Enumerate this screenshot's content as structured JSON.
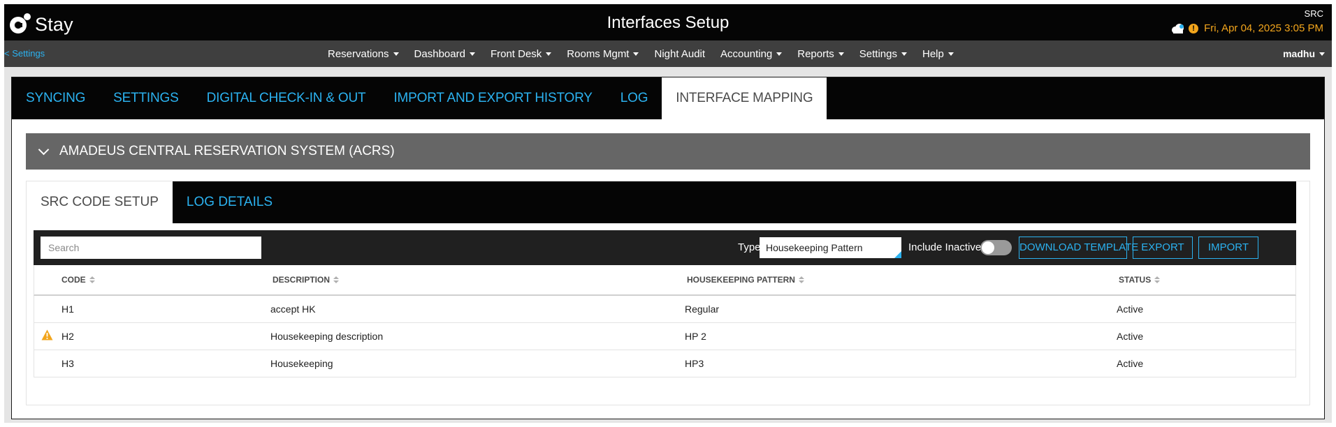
{
  "header": {
    "logo_text": "Stay",
    "title": "Interfaces Setup",
    "property_code": "SRC",
    "datetime": "Fri, Apr 04, 2025 3:05 PM",
    "warning_glyph": "!"
  },
  "nav": {
    "back_label": "<  Settings",
    "items": [
      {
        "label": "Reservations",
        "dropdown": true
      },
      {
        "label": "Dashboard",
        "dropdown": true
      },
      {
        "label": "Front Desk",
        "dropdown": true
      },
      {
        "label": "Rooms Mgmt",
        "dropdown": true
      },
      {
        "label": "Night Audit",
        "dropdown": false
      },
      {
        "label": "Accounting",
        "dropdown": true
      },
      {
        "label": "Reports",
        "dropdown": true
      },
      {
        "label": "Settings",
        "dropdown": true
      },
      {
        "label": "Help",
        "dropdown": true
      }
    ],
    "user": "madhu"
  },
  "main_tabs": [
    {
      "label": "SYNCING",
      "active": false
    },
    {
      "label": "SETTINGS",
      "active": false
    },
    {
      "label": "DIGITAL CHECK-IN & OUT",
      "active": false
    },
    {
      "label": "IMPORT AND EXPORT HISTORY",
      "active": false
    },
    {
      "label": "LOG",
      "active": false
    },
    {
      "label": "INTERFACE MAPPING",
      "active": true
    }
  ],
  "accordion": {
    "title": "AMADEUS CENTRAL RESERVATION SYSTEM (ACRS)"
  },
  "sub_tabs": [
    {
      "label": "SRC CODE SETUP",
      "active": true
    },
    {
      "label": "LOG DETAILS",
      "active": false
    }
  ],
  "toolbar": {
    "search_placeholder": "Search",
    "type_label": "Type",
    "type_value": "Housekeeping Pattern",
    "include_inactive_label": "Include Inactive",
    "include_inactive_on": false,
    "download_template_label": "DOWNLOAD TEMPLATE",
    "export_label": "EXPORT",
    "import_label": "IMPORT"
  },
  "table": {
    "columns": [
      "CODE",
      "DESCRIPTION",
      "HOUSEKEEPING PATTERN",
      "STATUS"
    ],
    "rows": [
      {
        "code": "H1",
        "description": "accept HK",
        "pattern": "Regular",
        "status": "Active",
        "warning": false
      },
      {
        "code": "H2",
        "description": "Housekeeping description",
        "pattern": "HP 2",
        "status": "Active",
        "warning": true
      },
      {
        "code": "H3",
        "description": "Housekeeping",
        "pattern": "HP3",
        "status": "Active",
        "warning": false
      }
    ]
  },
  "colors": {
    "accent": "#2bb2f0",
    "warning": "#f2a51c",
    "header_bg": "#050505",
    "nav_bg": "#3f3f3f",
    "accordion_bg": "#666666"
  }
}
